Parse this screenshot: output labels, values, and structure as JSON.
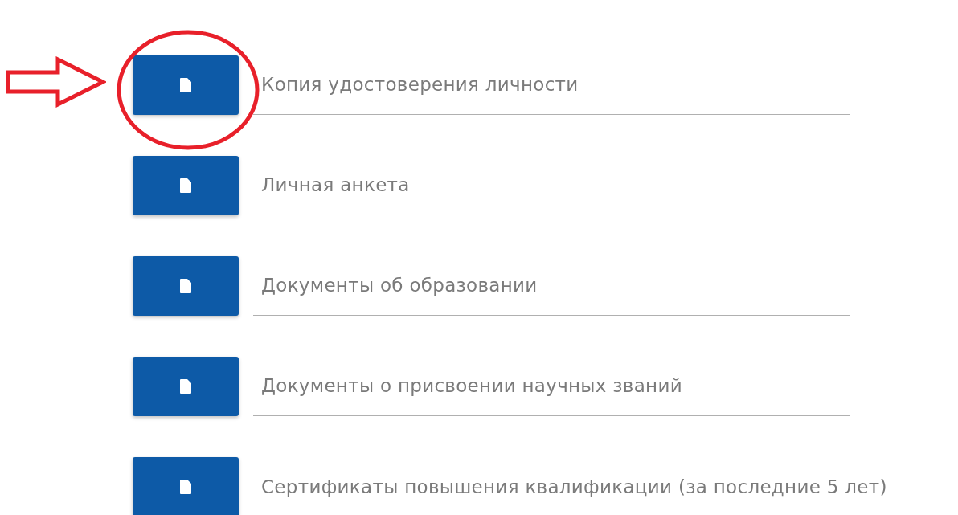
{
  "documents": [
    {
      "label": "Копия удостоверения личности"
    },
    {
      "label": "Личная анкета"
    },
    {
      "label": "Документы об образовании"
    },
    {
      "label": "Документы о присвоении научных званий"
    },
    {
      "label": "Сертификаты повышения квалификации (за последние 5 лет)"
    }
  ]
}
